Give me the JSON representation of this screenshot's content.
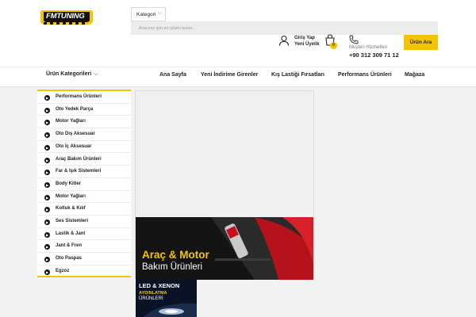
{
  "logo": {
    "text": "FMTUNING"
  },
  "search": {
    "category_label": "Kategori",
    "placeholder": "Aracınız için en iyisini bulun...",
    "button": "Ürün Ara"
  },
  "account": {
    "login": "Giriş Yap",
    "register": "Yeni Üyelik"
  },
  "cart": {
    "count": "0"
  },
  "support": {
    "label": "Müşteri Hizmetleri",
    "phone": "+90 312 309 71 12"
  },
  "nav": {
    "categories_label": "Ürün Kategorileri",
    "links": [
      "Ana Sayfa",
      "Yeni İndirime Girenler",
      "Kış Lastiği Fırsatları",
      "Performans Ürünleri",
      "Mağaza"
    ]
  },
  "sidebar": {
    "items": [
      "Performans Ürünleri",
      "Oto Yedek Parça",
      "Motor Yağları",
      "Oto Dış Aksesuar",
      "Oto İç Aksesuar",
      "Araç Bakım Ürünleri",
      "Far & Işık Sistemleri",
      "Body Kitler",
      "Motor Yağları",
      "Koltuk & Kılıf",
      "Ses Sistemleri",
      "Lastik & Jant",
      "Jant & Fren",
      "Oto Paspas",
      "Egzoz"
    ]
  },
  "banners": {
    "care": {
      "title": "Araç & Motor",
      "subtitle": "Bakım Ürünleri"
    },
    "led": {
      "line1": "LED & XENON",
      "line2": "AYDINLATMA",
      "line3": "ÜRÜNLERİ"
    }
  },
  "colors": {
    "accent": "#f5c400",
    "dark": "#111111"
  }
}
